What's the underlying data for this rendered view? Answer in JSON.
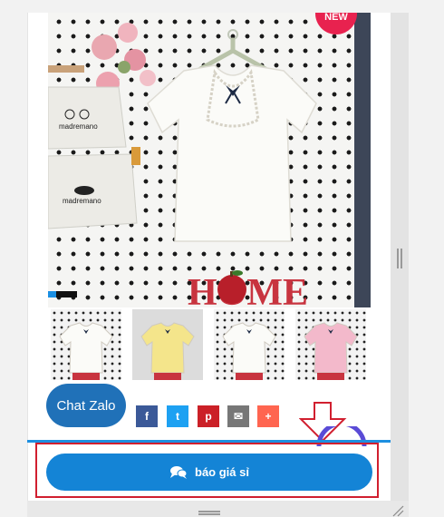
{
  "badge": {
    "text": "NEW"
  },
  "product_image": {
    "logo_text": "madremano",
    "decor_text": "HOME"
  },
  "thumbnails": [
    {
      "name": "white-blouse-front",
      "shirt_color": "#fbfbf8"
    },
    {
      "name": "yellow-blouse",
      "shirt_color": "#f4e58b"
    },
    {
      "name": "white-blouse-alt",
      "shirt_color": "#fbfbf8"
    },
    {
      "name": "pink-blouse",
      "shirt_color": "#f3b9cb"
    }
  ],
  "chat": {
    "label": "Chat Zalo"
  },
  "share_buttons": [
    {
      "name": "facebook",
      "glyph": "f",
      "color": "#3b5998"
    },
    {
      "name": "twitter",
      "glyph": "t",
      "color": "#1da1f2"
    },
    {
      "name": "pinterest",
      "glyph": "p",
      "color": "#cb2027"
    },
    {
      "name": "email",
      "glyph": "✉",
      "color": "#777777"
    },
    {
      "name": "more",
      "glyph": "+",
      "color": "#ff6550"
    }
  ],
  "quote_button": {
    "label": "báo giá sỉ",
    "icon": "chat-bubbles-icon"
  },
  "colors": {
    "accent": "#1484d6",
    "highlight_border": "#d11f2f"
  }
}
